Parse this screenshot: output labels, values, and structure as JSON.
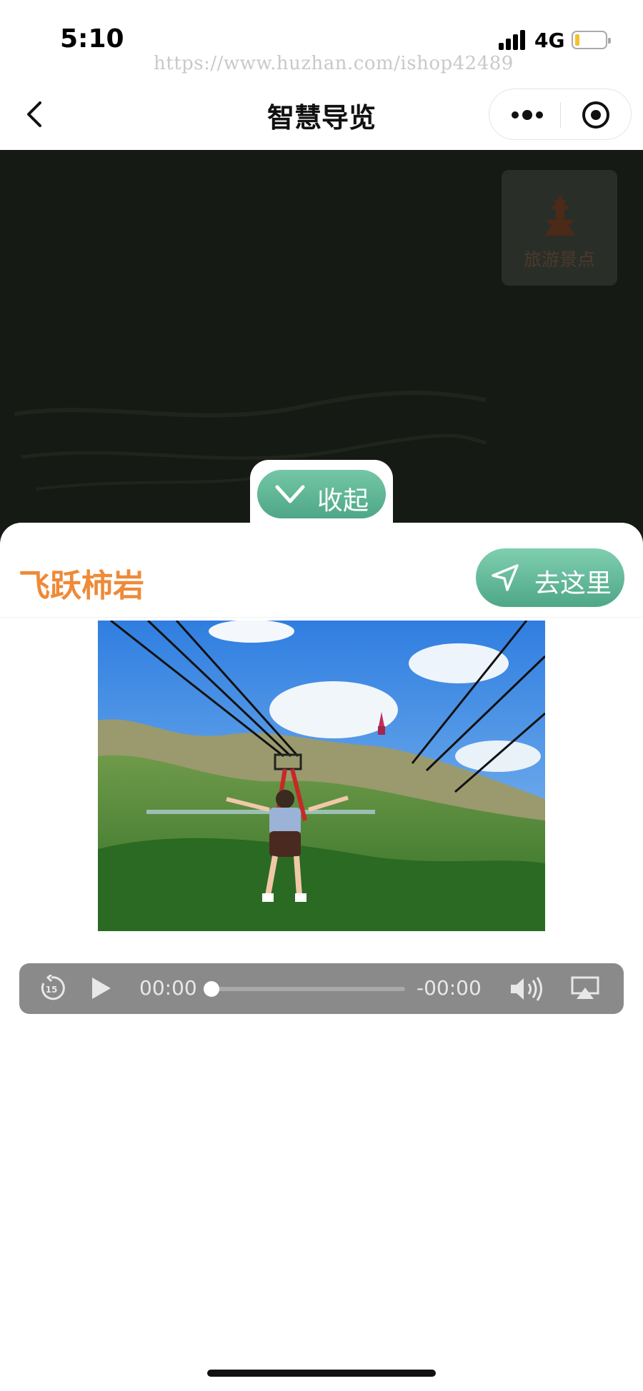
{
  "status_bar": {
    "time": "5:10",
    "network": "4G",
    "watermark": "https://www.huzhan.com/ishop42489"
  },
  "nav": {
    "title": "智慧导览",
    "back_icon": "chevron-left-icon",
    "more_icon": "more-dots-icon",
    "close_icon": "target-close-icon"
  },
  "map": {
    "scenic_button_label": "旅游景点",
    "scenic_icon": "tower-icon",
    "background_color": "#161a14"
  },
  "collapse": {
    "label": "收起",
    "icon": "chevron-down-icon"
  },
  "spot": {
    "title": "飞跃柿岩",
    "goto_label": "去这里",
    "goto_icon": "navigation-arrow-icon",
    "title_color": "#ee8a38",
    "accent_color": "#5cb394"
  },
  "audio_player": {
    "current_time": "00:00",
    "remaining_time": "-00:00",
    "progress": 0,
    "skip_back_label": "15",
    "icons": [
      "skip-back-15-icon",
      "play-icon",
      "volume-icon",
      "airplay-icon"
    ]
  }
}
